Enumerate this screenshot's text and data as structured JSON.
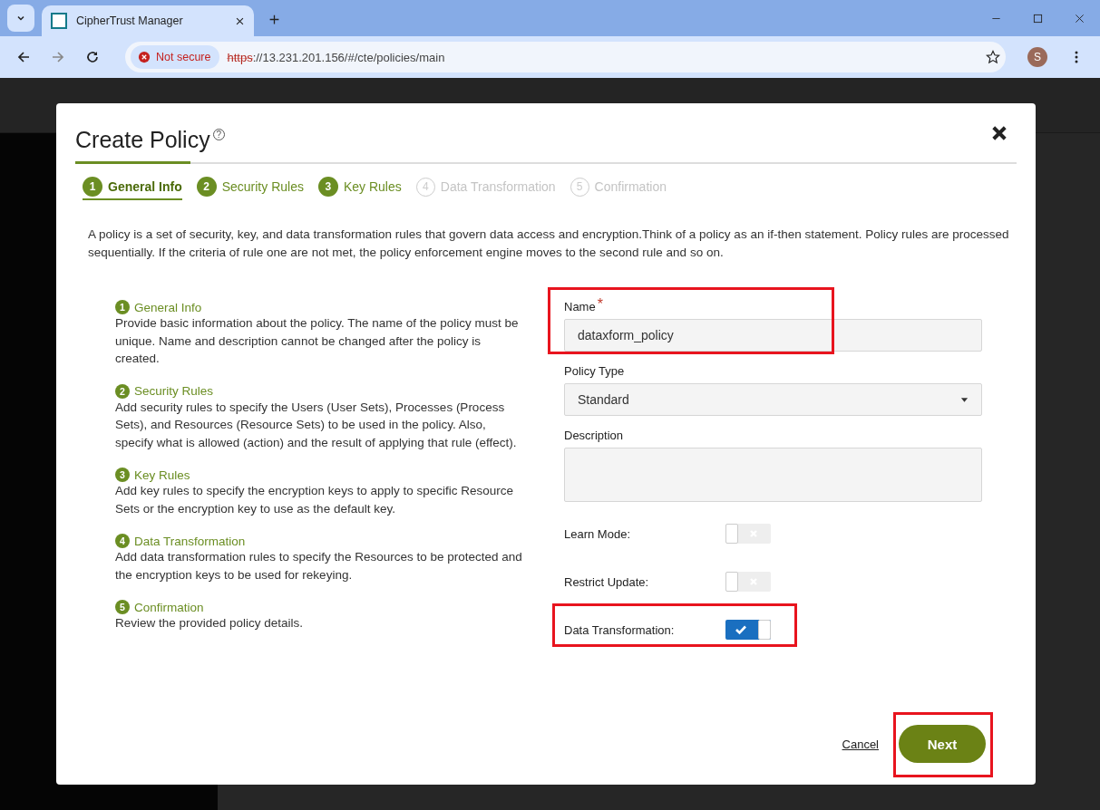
{
  "browser": {
    "tab": {
      "title": "CipherTrust Manager"
    },
    "security_chip": "Not secure",
    "url": {
      "scheme": "https",
      "rest": "://13.231.201.156/#/cte/policies/main"
    },
    "profile_initial": "S"
  },
  "dialog": {
    "title": "Create Policy",
    "help_mark": "?",
    "steps": [
      {
        "number": "1",
        "label": "General Info",
        "enabled": true,
        "selected": true
      },
      {
        "number": "2",
        "label": "Security Rules",
        "enabled": true,
        "selected": false
      },
      {
        "number": "3",
        "label": "Key Rules",
        "enabled": true,
        "selected": false
      },
      {
        "number": "4",
        "label": "Data Transformation",
        "enabled": false,
        "selected": false
      },
      {
        "number": "5",
        "label": "Confirmation",
        "enabled": false,
        "selected": false
      }
    ],
    "intro": "A policy is a set of security, key, and data transformation rules that govern data access and encryption.Think of a policy as an if-then statement. Policy rules are processed sequentially. If the criteria of rule one are not met, the policy enforcement engine moves to the second rule and so on.",
    "sections": [
      {
        "number": "1",
        "title": "General Info",
        "text": "Provide basic information about the policy. The name of the policy must be unique. Name and description cannot be changed after the policy is created."
      },
      {
        "number": "2",
        "title": "Security Rules",
        "text": "Add security rules to specify the Users (User Sets), Processes (Process Sets), and Resources (Resource Sets) to be used in the policy. Also, specify what is allowed (action) and the result of applying that rule (effect)."
      },
      {
        "number": "3",
        "title": "Key Rules",
        "text": "Add key rules to specify the encryption keys to apply to specific Resource Sets or the encryption key to use as the default key."
      },
      {
        "number": "4",
        "title": "Data Transformation",
        "text": "Add data transformation rules to specify the Resources to be protected and the encryption keys to be used for rekeying."
      },
      {
        "number": "5",
        "title": "Confirmation",
        "text": "Review the provided policy details."
      }
    ],
    "name_field": {
      "label": "Name",
      "required_mark": "*",
      "value": "dataxform_policy",
      "highlighted": true
    },
    "policy_type": {
      "label": "Policy Type",
      "value": "Standard"
    },
    "description": {
      "label": "Description"
    },
    "toggles": [
      {
        "label": "Learn Mode:",
        "on": false,
        "highlighted": false
      },
      {
        "label": "Restrict Update:",
        "on": false,
        "highlighted": false
      },
      {
        "label": "Data Transformation:",
        "on": true,
        "highlighted": true
      }
    ],
    "cancel": "Cancel",
    "next": {
      "label": "Next",
      "highlighted": true
    }
  }
}
